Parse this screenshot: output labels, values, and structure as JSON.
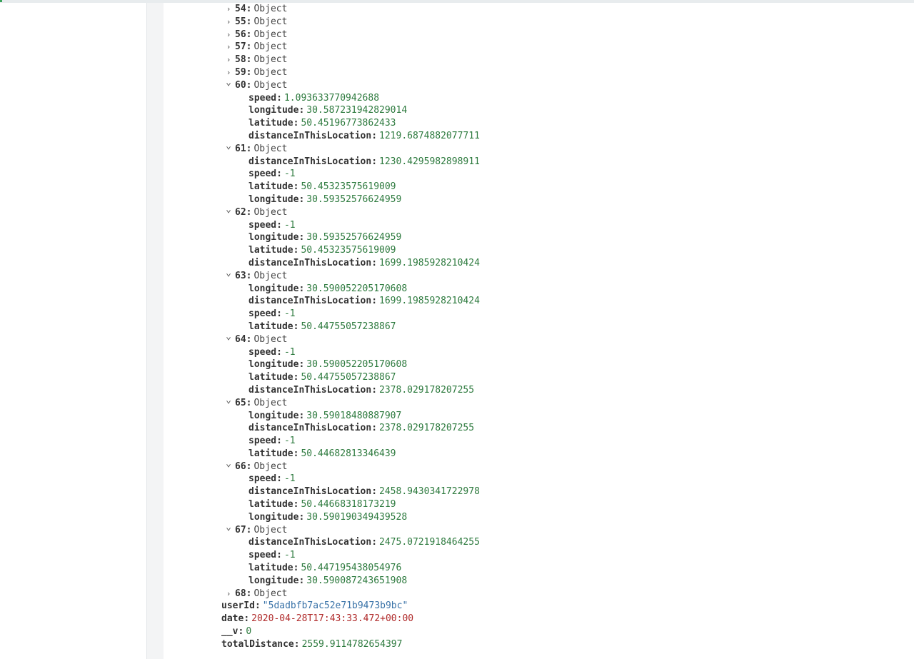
{
  "theme": {
    "key_color": "#333333",
    "number_color": "#2d7a3e",
    "string_color": "#3a73a8",
    "date_color": "#b02a2a",
    "type_color": "#444444"
  },
  "rows": [
    {
      "depth": 1,
      "key": "54",
      "value": "Object",
      "kind": "type",
      "caret": "collapsed"
    },
    {
      "depth": 1,
      "key": "55",
      "value": "Object",
      "kind": "type",
      "caret": "collapsed"
    },
    {
      "depth": 1,
      "key": "56",
      "value": "Object",
      "kind": "type",
      "caret": "collapsed"
    },
    {
      "depth": 1,
      "key": "57",
      "value": "Object",
      "kind": "type",
      "caret": "collapsed"
    },
    {
      "depth": 1,
      "key": "58",
      "value": "Object",
      "kind": "type",
      "caret": "collapsed"
    },
    {
      "depth": 1,
      "key": "59",
      "value": "Object",
      "kind": "type",
      "caret": "collapsed"
    },
    {
      "depth": 1,
      "key": "60",
      "value": "Object",
      "kind": "type",
      "caret": "expanded"
    },
    {
      "depth": 2,
      "key": "speed",
      "value": "1.093633770942688",
      "kind": "num"
    },
    {
      "depth": 2,
      "key": "longitude",
      "value": "30.587231942829014",
      "kind": "num"
    },
    {
      "depth": 2,
      "key": "latitude",
      "value": "50.45196773862433",
      "kind": "num"
    },
    {
      "depth": 2,
      "key": "distanceInThisLocation",
      "value": "1219.6874882077711",
      "kind": "num"
    },
    {
      "depth": 1,
      "key": "61",
      "value": "Object",
      "kind": "type",
      "caret": "expanded"
    },
    {
      "depth": 2,
      "key": "distanceInThisLocation",
      "value": "1230.4295982898911",
      "kind": "num"
    },
    {
      "depth": 2,
      "key": "speed",
      "value": "-1",
      "kind": "num"
    },
    {
      "depth": 2,
      "key": "latitude",
      "value": "50.45323575619009",
      "kind": "num"
    },
    {
      "depth": 2,
      "key": "longitude",
      "value": "30.59352576624959",
      "kind": "num"
    },
    {
      "depth": 1,
      "key": "62",
      "value": "Object",
      "kind": "type",
      "caret": "expanded"
    },
    {
      "depth": 2,
      "key": "speed",
      "value": "-1",
      "kind": "num"
    },
    {
      "depth": 2,
      "key": "longitude",
      "value": "30.59352576624959",
      "kind": "num"
    },
    {
      "depth": 2,
      "key": "latitude",
      "value": "50.45323575619009",
      "kind": "num"
    },
    {
      "depth": 2,
      "key": "distanceInThisLocation",
      "value": "1699.1985928210424",
      "kind": "num"
    },
    {
      "depth": 1,
      "key": "63",
      "value": "Object",
      "kind": "type",
      "caret": "expanded"
    },
    {
      "depth": 2,
      "key": "longitude",
      "value": "30.590052205170608",
      "kind": "num"
    },
    {
      "depth": 2,
      "key": "distanceInThisLocation",
      "value": "1699.1985928210424",
      "kind": "num"
    },
    {
      "depth": 2,
      "key": "speed",
      "value": "-1",
      "kind": "num"
    },
    {
      "depth": 2,
      "key": "latitude",
      "value": "50.44755057238867",
      "kind": "num"
    },
    {
      "depth": 1,
      "key": "64",
      "value": "Object",
      "kind": "type",
      "caret": "expanded"
    },
    {
      "depth": 2,
      "key": "speed",
      "value": "-1",
      "kind": "num"
    },
    {
      "depth": 2,
      "key": "longitude",
      "value": "30.590052205170608",
      "kind": "num"
    },
    {
      "depth": 2,
      "key": "latitude",
      "value": "50.44755057238867",
      "kind": "num"
    },
    {
      "depth": 2,
      "key": "distanceInThisLocation",
      "value": "2378.029178207255",
      "kind": "num"
    },
    {
      "depth": 1,
      "key": "65",
      "value": "Object",
      "kind": "type",
      "caret": "expanded"
    },
    {
      "depth": 2,
      "key": "longitude",
      "value": "30.59018480887907",
      "kind": "num"
    },
    {
      "depth": 2,
      "key": "distanceInThisLocation",
      "value": "2378.029178207255",
      "kind": "num"
    },
    {
      "depth": 2,
      "key": "speed",
      "value": "-1",
      "kind": "num"
    },
    {
      "depth": 2,
      "key": "latitude",
      "value": "50.44682813346439",
      "kind": "num"
    },
    {
      "depth": 1,
      "key": "66",
      "value": "Object",
      "kind": "type",
      "caret": "expanded"
    },
    {
      "depth": 2,
      "key": "speed",
      "value": "-1",
      "kind": "num"
    },
    {
      "depth": 2,
      "key": "distanceInThisLocation",
      "value": "2458.9430341722978",
      "kind": "num"
    },
    {
      "depth": 2,
      "key": "latitude",
      "value": "50.44668318173219",
      "kind": "num"
    },
    {
      "depth": 2,
      "key": "longitude",
      "value": "30.590190349439528",
      "kind": "num"
    },
    {
      "depth": 1,
      "key": "67",
      "value": "Object",
      "kind": "type",
      "caret": "expanded"
    },
    {
      "depth": 2,
      "key": "distanceInThisLocation",
      "value": "2475.0721918464255",
      "kind": "num"
    },
    {
      "depth": 2,
      "key": "speed",
      "value": "-1",
      "kind": "num"
    },
    {
      "depth": 2,
      "key": "latitude",
      "value": "50.447195438054976",
      "kind": "num"
    },
    {
      "depth": 2,
      "key": "longitude",
      "value": "30.590087243651908",
      "kind": "num"
    },
    {
      "depth": 1,
      "key": "68",
      "value": "Object",
      "kind": "type",
      "caret": "collapsed"
    },
    {
      "depth": 0,
      "key": "userId",
      "value": "\"5dadbfb7ac52e71b9473b9bc\"",
      "kind": "str"
    },
    {
      "depth": 0,
      "key": "date",
      "value": "2020-04-28T17:43:33.472+00:00",
      "kind": "date"
    },
    {
      "depth": 0,
      "key": "__v",
      "value": "0",
      "kind": "num"
    },
    {
      "depth": 0,
      "key": "totalDistance",
      "value": "2559.9114782654397",
      "kind": "num"
    }
  ]
}
